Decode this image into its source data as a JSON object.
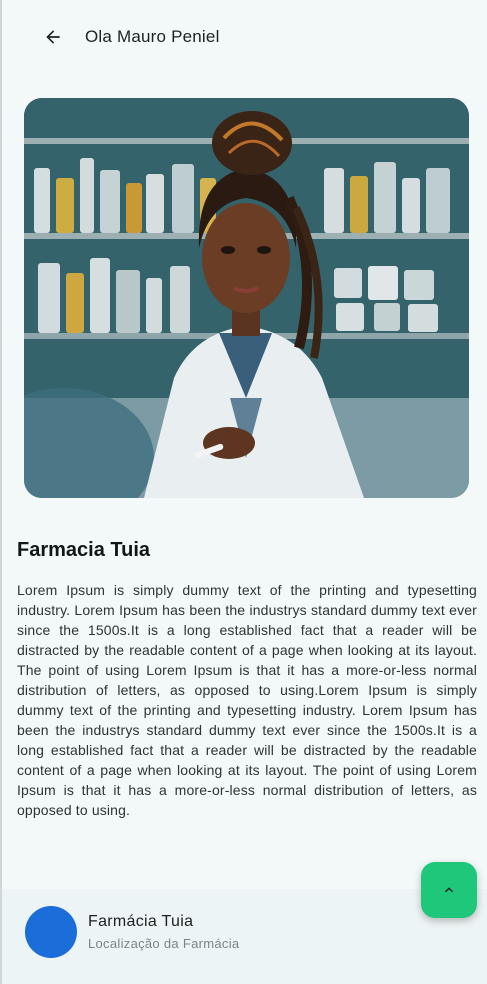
{
  "header": {
    "title": "Ola Mauro Peniel",
    "back_icon": "arrow-left-icon"
  },
  "pharmacy": {
    "name": "Farmacia Tuia",
    "description": "Lorem Ipsum is simply dummy text of the printing and typesetting industry. Lorem Ipsum has been the industrys standard dummy text ever since the 1500s.It is a long established fact that a reader will be distracted by the readable content of a page when looking at its layout. The point of using Lorem Ipsum is that it has a more-or-less normal distribution of letters, as opposed to using.Lorem Ipsum is simply dummy text of the printing and typesetting industry. Lorem Ipsum has been the industrys standard dummy text ever since the 1500s.It is a long established fact that a reader will be distracted by the readable content of a page when looking at its layout. The point of using Lorem Ipsum is that it has a more-or-less normal distribution of letters, as opposed to using."
  },
  "footer_card": {
    "title": "Farmácia Tuia",
    "subtitle": "Localização da Farmácia",
    "avatar_color": "#1b6ed9"
  },
  "fab": {
    "icon": "chevron-up-icon",
    "color": "#1fc77a"
  }
}
